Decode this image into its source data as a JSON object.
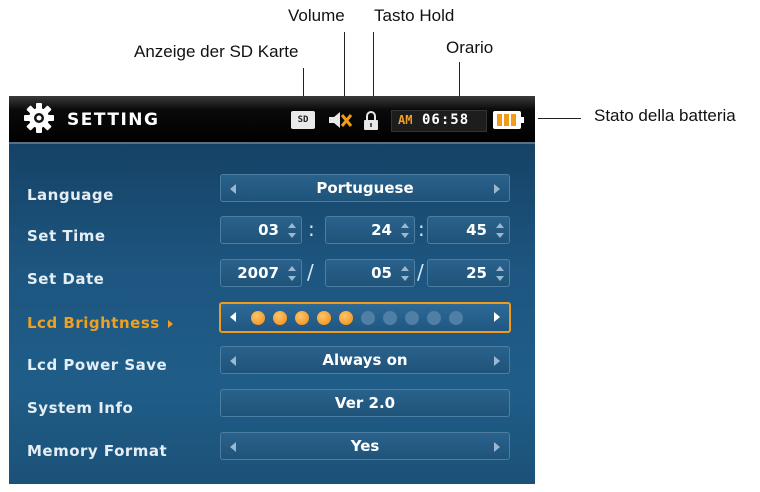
{
  "callouts": {
    "volume": "Volume",
    "hold": "Tasto Hold",
    "sd": "Anzeige der SD Karte",
    "time": "Orario",
    "battery": "Stato della batteria"
  },
  "header": {
    "title": "SETTING",
    "sd_label": "SD",
    "ampm": "AM",
    "time": "06:58"
  },
  "settings": {
    "language": {
      "label": "Language",
      "value": "Portuguese"
    },
    "set_time": {
      "label": "Set Time",
      "hour": "03",
      "minute": "24",
      "second": "45"
    },
    "set_date": {
      "label": "Set Date",
      "year": "2007",
      "month": "05",
      "day": "25"
    },
    "lcd_brightness": {
      "label": "Lcd Brightness",
      "level": 5,
      "max": 10
    },
    "lcd_power_save": {
      "label": "Lcd Power Save",
      "value": "Always on"
    },
    "system_info": {
      "label": "System Info",
      "value": "Ver 2.0"
    },
    "memory_format": {
      "label": "Memory Format",
      "value": "Yes"
    }
  },
  "colors": {
    "accent": "#f29a1a",
    "background": "#1d5680",
    "text": "#e6eef5"
  }
}
